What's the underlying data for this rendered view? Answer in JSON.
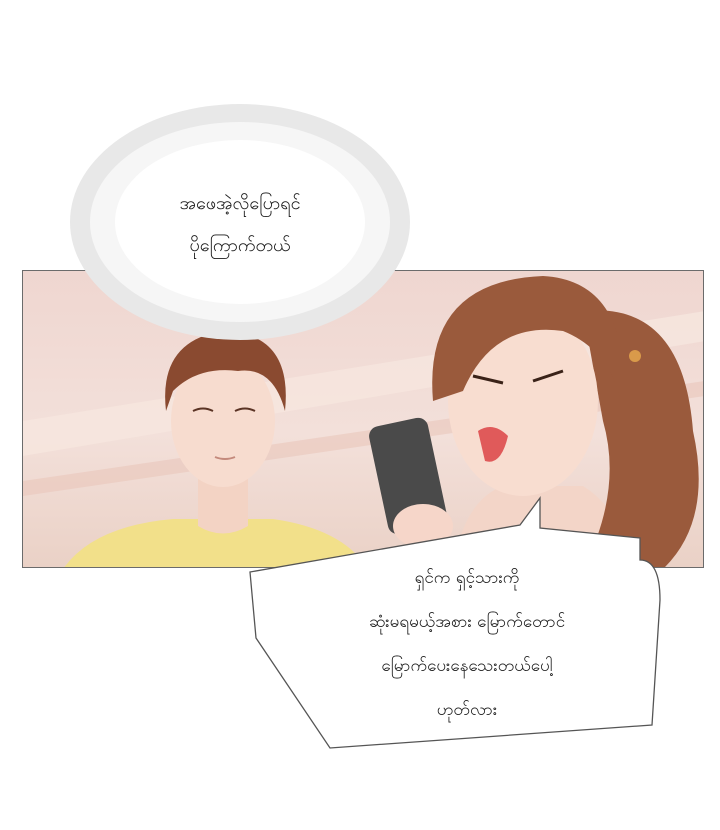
{
  "thought_bubble": {
    "lines": [
      "အဖေအဲ့လိုပြောရင်",
      "ပိုကြောက်တယ်"
    ]
  },
  "speech_bubble": {
    "lines": [
      "ရှင်က ရှင့်သားကို",
      "ဆုံးမရမယ့်အစား မြောက်တောင်",
      "မြောက်ပေးနေသေးတယ်ပေါ့",
      "ဟုတ်လား"
    ]
  },
  "colors": {
    "panel_background": "#efd6d0",
    "boy_shirt": "#f2e08a",
    "hair": "#8a4a30",
    "phone": "#4a4a4a"
  }
}
